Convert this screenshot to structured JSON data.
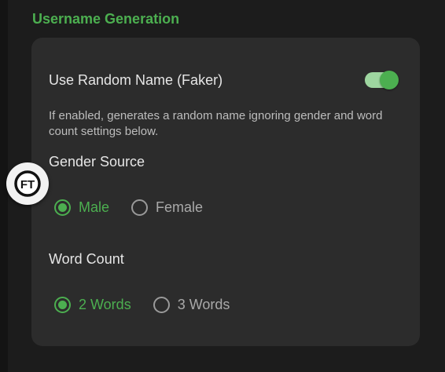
{
  "section": {
    "title": "Username Generation"
  },
  "random_name": {
    "label": "Use Random Name (Faker)",
    "enabled": true,
    "description": "If enabled, generates a random name ignoring gender and word count settings below."
  },
  "gender_source": {
    "label": "Gender Source",
    "options": [
      {
        "label": "Male",
        "selected": true
      },
      {
        "label": "Female",
        "selected": false
      }
    ]
  },
  "word_count": {
    "label": "Word Count",
    "options": [
      {
        "label": "2 Words",
        "selected": true
      },
      {
        "label": "3 Words",
        "selected": false
      }
    ]
  },
  "floating_button": {
    "icon": "ft-logo-icon",
    "text": "FT"
  },
  "colors": {
    "accent": "#4caf50",
    "background": "#1c1c1c",
    "card": "#2c2c2c",
    "text": "#e6e6e6",
    "muted_text": "#bdbdbd"
  }
}
